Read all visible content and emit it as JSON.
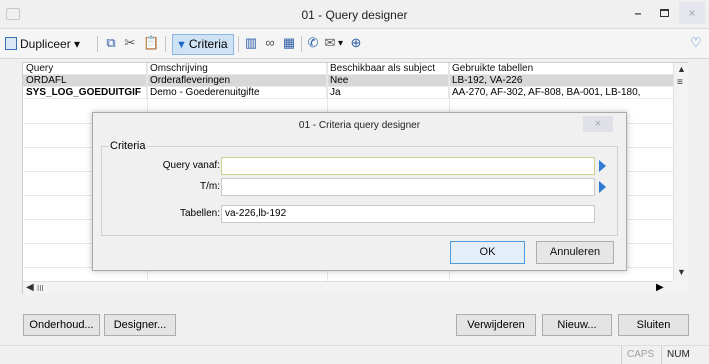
{
  "window": {
    "title": "01 - Query designer",
    "minimize_glyph": "–",
    "close_glyph": "×"
  },
  "toolbar": {
    "duplicate_label": "Dupliceer",
    "criteria_label": "Criteria",
    "dropdown_glyph": "▾",
    "heart_glyph": "♡"
  },
  "grid": {
    "columns": [
      "Query",
      "Omschrijving",
      "Beschikbaar als subject",
      "Gebruikte tabellen"
    ],
    "rows": [
      [
        "ORDAFL",
        "Orderafleveringen",
        "Nee",
        "LB-192, VA-226"
      ],
      [
        "SYS_LOG_GOEDUITGIF",
        "Demo - Goederenuitgifte",
        "Ja",
        "AA-270, AF-302, AF-808, BA-001, LB-180,"
      ]
    ],
    "hscroll_thumb": "III"
  },
  "dialog": {
    "title": "01 - Criteria query designer",
    "close_glyph": "×",
    "group_label": "Criteria",
    "query_from_label": "Query vanaf:",
    "query_from_value": "",
    "query_to_label": "T/m:",
    "query_to_value": "",
    "tables_label": "Tabellen:",
    "tables_value": "va-226,lb-192",
    "ok_label": "OK",
    "cancel_label": "Annuleren"
  },
  "buttons": {
    "maintenance": "Onderhoud...",
    "designer": "Designer...",
    "delete": "Verwijderen",
    "new": "Nieuw...",
    "close": "Sluiten"
  },
  "status": {
    "caps": "CAPS",
    "num": "NUM"
  }
}
